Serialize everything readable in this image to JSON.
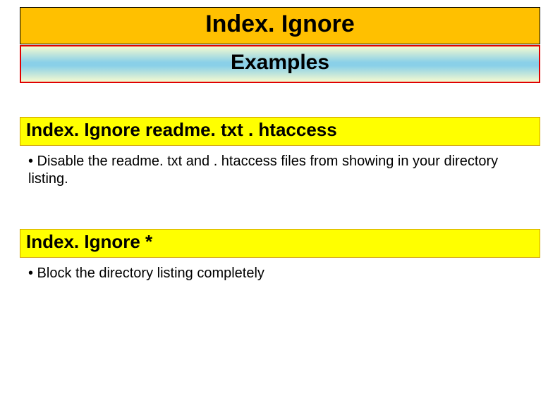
{
  "title": "Index. Ignore",
  "subtitle": "Examples",
  "example1": {
    "header": "Index. Ignore  readme. txt . htaccess",
    "desc": "• Disable the readme. txt and . htaccess files from showing in your directory listing."
  },
  "example2": {
    "header": "Index. Ignore  *",
    "desc": "• Block the directory listing completely"
  }
}
